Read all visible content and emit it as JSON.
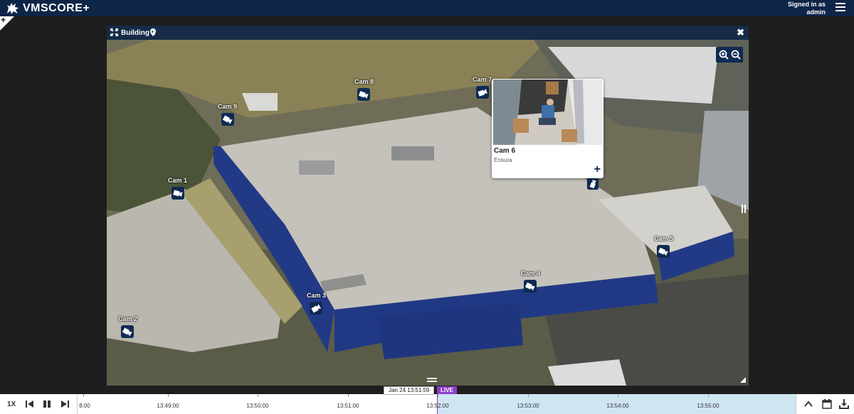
{
  "app": {
    "name": "VMSCORE+",
    "signed_in_label": "Signed in as",
    "user": "admin"
  },
  "panel": {
    "title": "Building 1"
  },
  "cameras": [
    {
      "label": "Cam 8"
    },
    {
      "label": "Cam 7"
    },
    {
      "label": "Cam 9"
    },
    {
      "label": "Cam 1"
    },
    {
      "label": "Cam 5"
    },
    {
      "label": "Cam 4"
    },
    {
      "label": "Cam 3"
    },
    {
      "label": "Cam 2"
    }
  ],
  "popup": {
    "title": "Cam 6",
    "subtitle": "Ensura"
  },
  "timeline": {
    "speed": "1X",
    "current_time": "Jan 24 13:51:59",
    "live_label": "LIVE",
    "ticks": [
      "8:00",
      "13:49:00",
      "13:50:00",
      "13:51:00",
      "13:52:00",
      "13:53:00",
      "13:54:00",
      "13:55:00"
    ]
  },
  "icons": {
    "logo": "lion-icon",
    "menu": "hamburger-icon",
    "expand": "expand-icon",
    "pin": "location-pin-icon",
    "close": "close-icon",
    "zoom_in": "zoom-in-icon",
    "zoom_out": "zoom-out-icon",
    "camera": "camera-icon",
    "add": "plus-icon",
    "prev": "skip-back-icon",
    "pause": "pause-icon",
    "next": "skip-forward-icon",
    "up": "chevron-up-icon",
    "calendar": "calendar-icon",
    "download": "download-icon"
  },
  "colors": {
    "header": "#0d2547",
    "marker": "#0f2a52",
    "live": "#8b3fc8",
    "timeline_live_zone": "#cfe6f2"
  }
}
